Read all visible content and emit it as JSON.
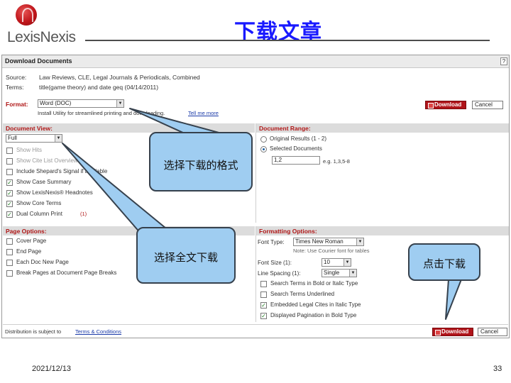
{
  "slide": {
    "logo_text": "LexisNexis",
    "title": "下载文章",
    "date": "2021/12/13",
    "page_number": "33"
  },
  "window": {
    "title": "Download Documents",
    "help": "?",
    "source_label": "Source:",
    "source_value": "Law Reviews, CLE, Legal Journals & Periodicals, Combined",
    "terms_label": "Terms:",
    "terms_value": "title(game theory) and date geq (04/14/2011)",
    "format_label": "Format:",
    "format_value": "Word (DOC)",
    "format_note_text": "Install Utility for streamlined printing and downloading.",
    "format_note_link": "Tell me more",
    "download_label": "Download",
    "cancel_label": "Cancel"
  },
  "document_view": {
    "title": "Document View:",
    "selected": "Full",
    "options": [
      {
        "label": "Show Hits",
        "checked": false,
        "dim": true
      },
      {
        "label": "Show Cite List Overview",
        "checked": false,
        "dim": true
      },
      {
        "label": "Include Shepard's Signal if available",
        "checked": false,
        "dim": false
      },
      {
        "label": "Show Case Summary",
        "checked": true,
        "dim": false
      },
      {
        "label": "Show LexisNexis® Headnotes",
        "checked": true,
        "dim": false
      },
      {
        "label": "Show Core Terms",
        "checked": true,
        "dim": false
      },
      {
        "label": "Dual Column Print",
        "checked": true,
        "dim": false
      }
    ],
    "dual_column_note": "(1)"
  },
  "document_range": {
    "title": "Document Range:",
    "options": [
      {
        "label": "Original Results (1 - 2)",
        "selected": false
      },
      {
        "label": "Selected Documents",
        "selected": true
      }
    ],
    "selected_value": "1,2",
    "example": "e.g. 1,3,5-8"
  },
  "page_options": {
    "title": "Page Options:",
    "options": [
      {
        "label": "Cover Page",
        "checked": false
      },
      {
        "label": "End Page",
        "checked": false
      },
      {
        "label": "Each Doc New Page",
        "checked": false
      },
      {
        "label": "Break Pages at Document Page Breaks",
        "checked": false
      }
    ]
  },
  "formatting_options": {
    "title": "Formatting Options:",
    "font_type_label": "Font Type:",
    "font_type_value": "Times New Roman",
    "font_note": "Note: Use Courier font for tables",
    "font_size_label": "Font Size (1):",
    "font_size_value": "10",
    "line_spacing_label": "Line Spacing (1):",
    "line_spacing_value": "Single",
    "options": [
      {
        "label": "Search Terms in Bold or Italic Type",
        "checked": false
      },
      {
        "label": "Search Terms Underlined",
        "checked": false
      },
      {
        "label": "Embedded Legal Cites in Italic Type",
        "checked": true
      },
      {
        "label": "Displayed Pagination in Bold Type",
        "checked": true
      }
    ]
  },
  "bottom": {
    "distribution_text": "Distribution is subject to",
    "terms_link": "Terms & Conditions",
    "download_label": "Download",
    "cancel_label": "Cancel"
  },
  "callouts": {
    "format": "选择下载的格式",
    "full_text": "选择全文下载",
    "click_download": "点击下载"
  },
  "colors": {
    "title_blue": "#1a1aff",
    "section_red": "#b01717",
    "download_red": "#b0141a",
    "callout_fill": "#9fcdf1"
  }
}
